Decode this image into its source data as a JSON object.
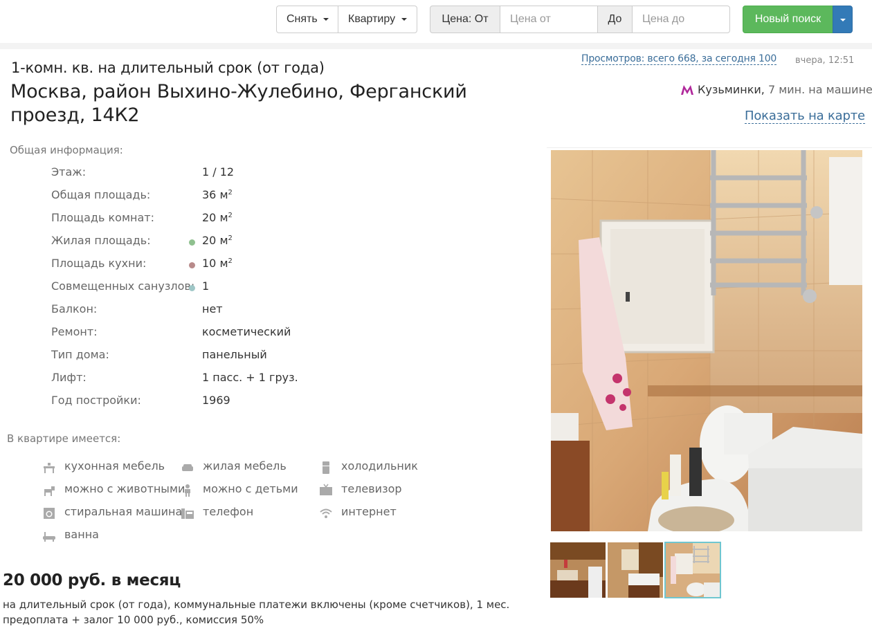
{
  "search": {
    "deal_label": "Снять",
    "type_label": "Квартиру",
    "price_from_label": "Цена: От",
    "price_from_placeholder": "Цена от",
    "price_to_label": "До",
    "price_to_placeholder": "Цена до",
    "new_search_label": "Новый поиск"
  },
  "header": {
    "subtitle": "1-комн. кв. на длительный срок (от года)",
    "address": "Москва, район Выхино-Жулебино, Ферганский проезд, 14К2",
    "views": "Просмотров: всего 668, за сегодня 100",
    "date": "вчера, 12:51",
    "metro_station": "Кузьминки,",
    "metro_time": "7 мин. на машине",
    "metro_icon": "metro-m-icon",
    "metro_color": "#b0289b",
    "show_map": "Показать на карте"
  },
  "general": {
    "title": "Общая информация:",
    "rows": [
      {
        "label": "Этаж:",
        "value": "1 / 12"
      },
      {
        "label": "Общая площадь:",
        "value": "36 м",
        "sup": "2"
      },
      {
        "label": "Площадь комнат:",
        "value": "20 м",
        "sup": "2"
      },
      {
        "label": "Жилая площадь:",
        "value": "20 м",
        "sup": "2",
        "dot": "#8fc08f"
      },
      {
        "label": "Площадь кухни:",
        "value": "10 м",
        "sup": "2",
        "dot": "#b88a8a"
      },
      {
        "label": "Совмещенных санузлов:",
        "value": "1",
        "dot": "#9fc7c7"
      },
      {
        "label": "Балкон:",
        "value": "нет"
      },
      {
        "label": "Ремонт:",
        "value": "косметический"
      },
      {
        "label": "Тип дома:",
        "value": "панельный"
      },
      {
        "label": "Лифт:",
        "value": "1 пасс. + 1 груз."
      },
      {
        "label": "Год постройки:",
        "value": "1969"
      }
    ]
  },
  "amenities": {
    "title": "В квартире имеется:",
    "items": [
      {
        "label": "кухонная мебель",
        "icon": "kitchen-furniture-icon"
      },
      {
        "label": "жилая мебель",
        "icon": "sofa-icon"
      },
      {
        "label": "холодильник",
        "icon": "fridge-icon"
      },
      {
        "label": "можно с животными",
        "icon": "pet-icon"
      },
      {
        "label": "можно с детьми",
        "icon": "child-icon"
      },
      {
        "label": "телевизор",
        "icon": "tv-icon"
      },
      {
        "label": "стиральная машина",
        "icon": "washing-machine-icon"
      },
      {
        "label": "телефон",
        "icon": "phone-icon"
      },
      {
        "label": "интернет",
        "icon": "wifi-icon"
      },
      {
        "label": "ванна",
        "icon": "bathtub-icon"
      }
    ]
  },
  "price": {
    "amount": "20 000 руб. в месяц",
    "description": "на длительный срок (от года), коммунальные платежи включены (кроме счетчиков), 1 мес. предоплата + залог 10 000 руб., комиссия 50%"
  },
  "gallery": {
    "active_index": 2,
    "thumb_count": 3
  }
}
